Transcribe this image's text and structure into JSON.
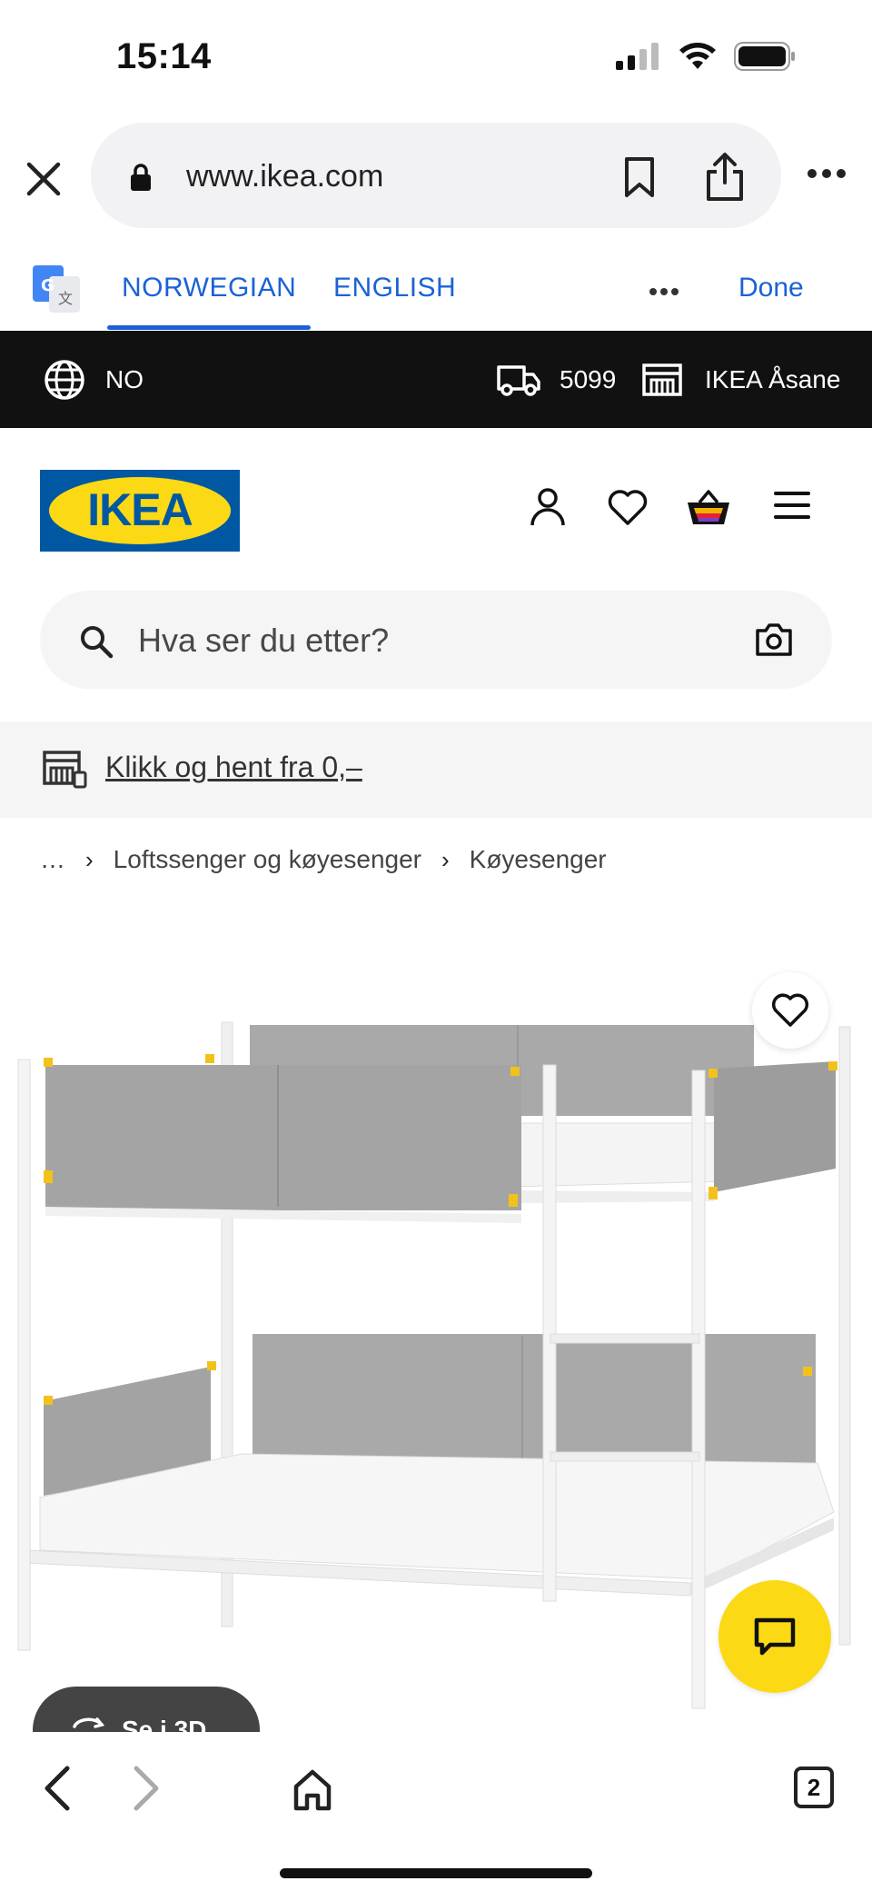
{
  "status_bar": {
    "time": "15:14"
  },
  "browser": {
    "url": "www.ikea.com"
  },
  "translate": {
    "tab_source": "NORWEGIAN",
    "tab_target": "ENGLISH",
    "done_label": "Done"
  },
  "top_bar": {
    "country": "NO",
    "postcode": "5099",
    "store": "IKEA Åsane"
  },
  "header": {
    "logo_text": "IKEA"
  },
  "search": {
    "placeholder": "Hva ser du etter?"
  },
  "promo": {
    "link_text": "Klikk og hent fra 0,–"
  },
  "breadcrumb": {
    "ellipsis": "…",
    "items": [
      "Loftssenger og køyesenger",
      "Køyesenger"
    ]
  },
  "product": {
    "view_3d_label": "Se i 3D"
  },
  "bottom_nav": {
    "tab_count": "2"
  },
  "colors": {
    "ikea_blue": "#0058a3",
    "ikea_yellow": "#fbd914",
    "link_blue": "#1a62d6"
  }
}
